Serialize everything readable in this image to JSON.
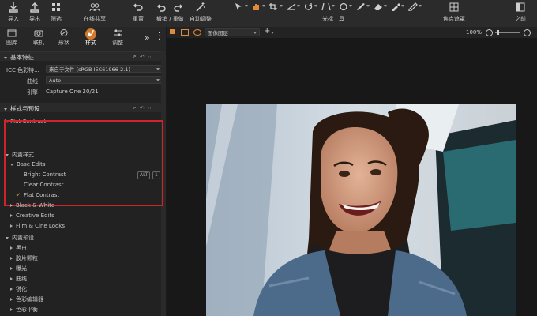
{
  "toolbar": {
    "buttons": [
      {
        "label": "导入",
        "icon": "import-icon"
      },
      {
        "label": "导出",
        "icon": "export-icon"
      },
      {
        "label": "筛选",
        "icon": "filter-icon"
      },
      {
        "label": "在线共享",
        "icon": "share-icon"
      },
      {
        "label": "重置",
        "icon": "reset-icon"
      },
      {
        "label": "撤销 / 重做",
        "icon": "undo-redo-icon"
      },
      {
        "label": "自动调整",
        "icon": "auto-adjust-icon"
      },
      {
        "label": "光标工具",
        "icon": "cursor-tools-icon"
      },
      {
        "label": "焦点遮罩",
        "icon": "focus-mask-icon"
      },
      {
        "label": "之前",
        "icon": "before-icon"
      }
    ]
  },
  "tabs": [
    {
      "label": "图库",
      "icon": "library-icon"
    },
    {
      "label": "联机",
      "icon": "tether-icon"
    },
    {
      "label": "形状",
      "icon": "shape-icon"
    },
    {
      "label": "样式",
      "icon": "styles-icon",
      "active": true
    },
    {
      "label": "调整",
      "icon": "adjust-icon"
    }
  ],
  "basic": {
    "title": "基本特征",
    "icc_label": "ICC 色彩特...",
    "icc_value": "来自于文件 (sRGB IEC61966-2.1)",
    "curve_label": "曲线",
    "curve_value": "Auto",
    "engine_label": "引擎",
    "engine_value": "Capture One 20/21"
  },
  "styles": {
    "title": "样式与预设",
    "current": "Flat Contrast",
    "builtin_styles": "内置样式",
    "base_edits": "Base Edits",
    "items": [
      "Bright Contrast",
      "Clear Contrast",
      "Flat Contrast"
    ],
    "shortcut_alt": "ALT",
    "shortcut_num": "1",
    "groups": [
      "Black & White",
      "Creative Edits",
      "Film & Cine Looks"
    ],
    "builtin_presets": "内置预设",
    "presets": [
      "黑白",
      "胶片颗粒",
      "曝光",
      "曲线",
      "锐化",
      "色彩编辑器",
      "色彩平衡"
    ]
  },
  "viewer": {
    "layer": "图像图层",
    "zoom": "100%"
  },
  "colors": {
    "accent": "#d07a2c",
    "highlight": "#d0232a"
  }
}
